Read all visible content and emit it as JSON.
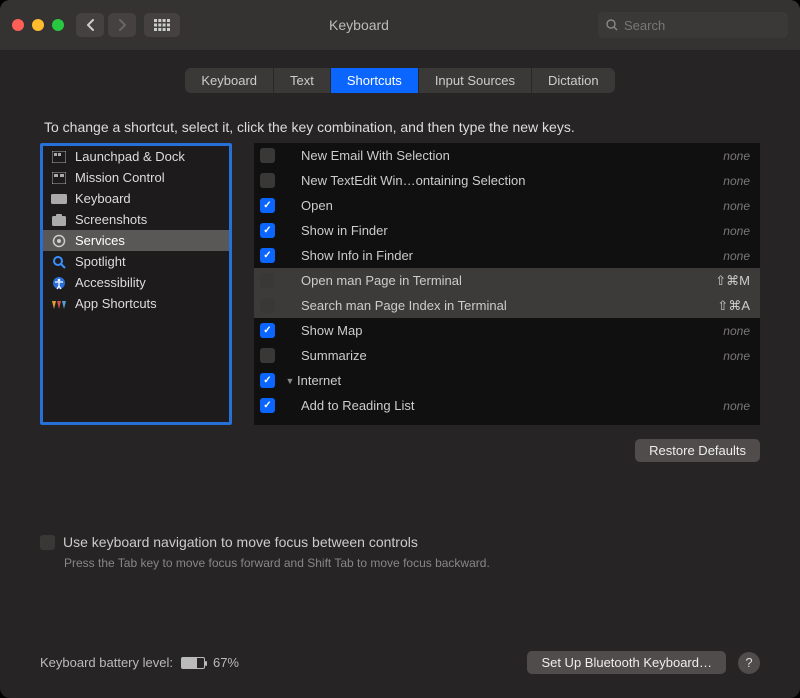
{
  "window": {
    "title": "Keyboard",
    "search_placeholder": "Search"
  },
  "tabs": [
    "Keyboard",
    "Text",
    "Shortcuts",
    "Input Sources",
    "Dictation"
  ],
  "active_tab": 2,
  "instruction": "To change a shortcut, select it, click the key combination, and then type the new keys.",
  "categories": [
    {
      "label": "Launchpad & Dock",
      "icon": "launchpad"
    },
    {
      "label": "Mission Control",
      "icon": "mission"
    },
    {
      "label": "Keyboard",
      "icon": "keyboard"
    },
    {
      "label": "Screenshots",
      "icon": "screenshots"
    },
    {
      "label": "Services",
      "icon": "services"
    },
    {
      "label": "Spotlight",
      "icon": "spotlight"
    },
    {
      "label": "Accessibility",
      "icon": "accessibility"
    },
    {
      "label": "App Shortcuts",
      "icon": "apps"
    }
  ],
  "selected_category": 4,
  "rows": [
    {
      "checked": false,
      "label": "New Email With Selection",
      "shortcut": "none",
      "none": true
    },
    {
      "checked": false,
      "label": "New TextEdit Win…ontaining Selection",
      "shortcut": "none",
      "none": true
    },
    {
      "checked": true,
      "label": "Open",
      "shortcut": "none",
      "none": true
    },
    {
      "checked": true,
      "label": "Show in Finder",
      "shortcut": "none",
      "none": true
    },
    {
      "checked": true,
      "label": "Show Info in Finder",
      "shortcut": "none",
      "none": true
    },
    {
      "checked": false,
      "label": "Open man Page in Terminal",
      "shortcut": "⇧⌘M",
      "none": false,
      "hl": true
    },
    {
      "checked": false,
      "label": "Search man Page Index in Terminal",
      "shortcut": "⇧⌘A",
      "none": false,
      "hl": true
    },
    {
      "checked": true,
      "label": "Show Map",
      "shortcut": "none",
      "none": true
    },
    {
      "checked": false,
      "label": "Summarize",
      "shortcut": "none",
      "none": true
    },
    {
      "checked": true,
      "label": "Internet",
      "group": true
    },
    {
      "checked": true,
      "label": "Add to Reading List",
      "shortcut": "none",
      "none": true
    }
  ],
  "restore_label": "Restore Defaults",
  "nav_option": "Use keyboard navigation to move focus between controls",
  "nav_hint": "Press the Tab key to move focus forward and Shift Tab to move focus backward.",
  "battery": {
    "label": "Keyboard battery level:",
    "pct": "67%"
  },
  "bluetooth_label": "Set Up Bluetooth Keyboard…"
}
